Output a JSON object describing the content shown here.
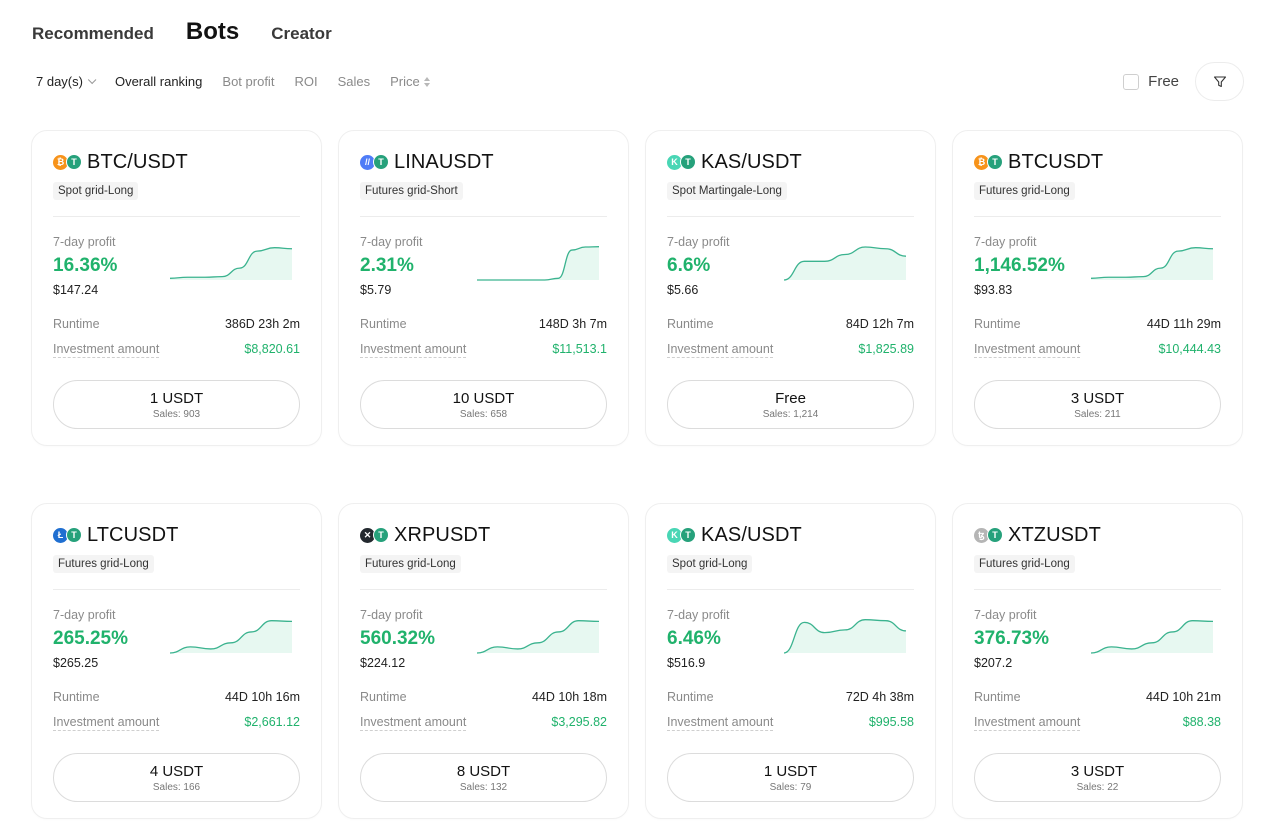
{
  "tabs": [
    {
      "label": "Recommended",
      "active": false
    },
    {
      "label": "Bots",
      "active": true
    },
    {
      "label": "Creator",
      "active": false
    }
  ],
  "filters": {
    "period": "7 day(s)",
    "sort_options": [
      "Overall ranking",
      "Bot profit",
      "ROI",
      "Sales"
    ],
    "active_sort": "Overall ranking",
    "price_label": "Price",
    "free_label": "Free",
    "free_checked": false,
    "filter_icon": "funnel-icon"
  },
  "labels": {
    "profit": "7-day profit",
    "runtime": "Runtime",
    "investment": "Investment amount"
  },
  "colors": {
    "accent_green": "#20b26c",
    "spark_fill": "#e7f8f1",
    "spark_line": "#3bb38f"
  },
  "bots": [
    {
      "pair": "BTC/USDT",
      "base_icon": {
        "name": "btc-icon",
        "glyph": "₿",
        "color": "#f7931a"
      },
      "strategy": "Spot grid-Long",
      "profit_pct": "16.36%",
      "profit_usd": "$147.24",
      "runtime": "386D 23h 2m",
      "investment": "$8,820.61",
      "price": "1 USDT",
      "sales": "Sales: 903",
      "trend": [
        0.05,
        0.08,
        0.08,
        0.1,
        0.35,
        0.85,
        0.95,
        0.92
      ]
    },
    {
      "pair": "LINAUSDT",
      "base_icon": {
        "name": "lina-icon",
        "glyph": "//",
        "color": "#4f7cf7"
      },
      "strategy": "Futures grid-Short",
      "profit_pct": "2.31%",
      "profit_usd": "$5.79",
      "runtime": "148D 3h 7m",
      "investment": "$11,513.1",
      "price": "10 USDT",
      "sales": "Sales: 658",
      "trend": [
        0.0,
        0.0,
        0.0,
        0.0,
        0.0,
        0.0,
        0.05,
        0.88,
        0.97,
        0.98
      ]
    },
    {
      "pair": "KAS/USDT",
      "base_icon": {
        "name": "kas-icon",
        "glyph": "K",
        "color": "#49d6b5"
      },
      "strategy": "Spot Martingale-Long",
      "profit_pct": "6.6%",
      "profit_usd": "$5.66",
      "runtime": "84D 12h 7m",
      "investment": "$1,825.89",
      "price": "Free",
      "sales": "Sales: 1,214",
      "trend": [
        0.0,
        0.55,
        0.55,
        0.75,
        0.97,
        0.92,
        0.7
      ]
    },
    {
      "pair": "BTCUSDT",
      "base_icon": {
        "name": "btc-icon",
        "glyph": "₿",
        "color": "#f7931a"
      },
      "strategy": "Futures grid-Long",
      "profit_pct": "1,146.52%",
      "profit_usd": "$93.83",
      "runtime": "44D 11h 29m",
      "investment": "$10,444.43",
      "price": "3 USDT",
      "sales": "Sales: 211",
      "trend": [
        0.05,
        0.08,
        0.08,
        0.1,
        0.35,
        0.85,
        0.95,
        0.92
      ]
    },
    {
      "pair": "LTCUSDT",
      "base_icon": {
        "name": "ltc-icon",
        "glyph": "Ł",
        "color": "#1f6fd1"
      },
      "strategy": "Futures grid-Long",
      "profit_pct": "265.25%",
      "profit_usd": "$265.25",
      "runtime": "44D 10h 16m",
      "investment": "$2,661.12",
      "price": "4 USDT",
      "sales": "Sales: 166",
      "trend": [
        0.0,
        0.18,
        0.12,
        0.3,
        0.62,
        0.95,
        0.93
      ]
    },
    {
      "pair": "XRPUSDT",
      "base_icon": {
        "name": "xrp-icon",
        "glyph": "✕",
        "color": "#23292f"
      },
      "strategy": "Futures grid-Long",
      "profit_pct": "560.32%",
      "profit_usd": "$224.12",
      "runtime": "44D 10h 18m",
      "investment": "$3,295.82",
      "price": "8 USDT",
      "sales": "Sales: 132",
      "trend": [
        0.0,
        0.18,
        0.12,
        0.3,
        0.62,
        0.95,
        0.93
      ]
    },
    {
      "pair": "KAS/USDT",
      "base_icon": {
        "name": "kas-icon",
        "glyph": "K",
        "color": "#49d6b5"
      },
      "strategy": "Spot grid-Long",
      "profit_pct": "6.46%",
      "profit_usd": "$516.9",
      "runtime": "72D 4h 38m",
      "investment": "$995.58",
      "price": "1 USDT",
      "sales": "Sales: 79",
      "trend": [
        0.0,
        0.9,
        0.6,
        0.68,
        0.98,
        0.95,
        0.65
      ]
    },
    {
      "pair": "XTZUSDT",
      "base_icon": {
        "name": "xtz-icon",
        "glyph": "ꜩ",
        "color": "#b5b5b5"
      },
      "strategy": "Futures grid-Long",
      "profit_pct": "376.73%",
      "profit_usd": "$207.2",
      "runtime": "44D 10h 21m",
      "investment": "$88.38",
      "price": "3 USDT",
      "sales": "Sales: 22",
      "trend": [
        0.0,
        0.18,
        0.12,
        0.3,
        0.62,
        0.95,
        0.93
      ]
    }
  ],
  "quote_icon": {
    "name": "usdt-icon",
    "glyph": "T",
    "color": "#26a17b"
  }
}
